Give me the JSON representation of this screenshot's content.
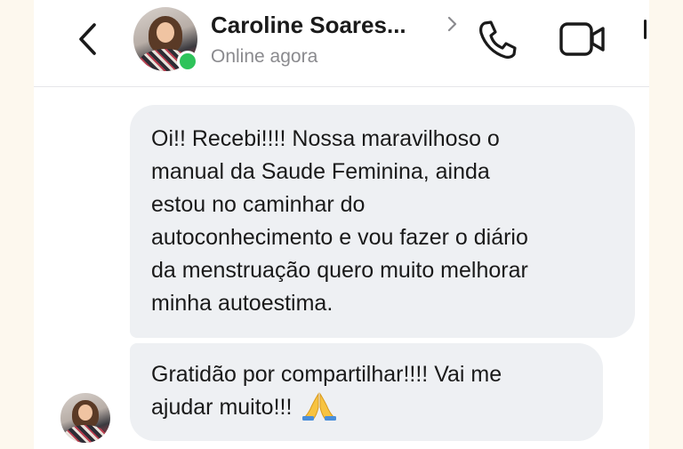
{
  "header": {
    "contact_name": "Caroline Soares...",
    "status": "Online agora",
    "icons": {
      "back": "back-chevron-icon",
      "name_chevron": "chevron-right-icon",
      "call": "phone-icon",
      "video": "video-camera-icon",
      "more": "more-icon"
    },
    "online_color": "#2ec35a"
  },
  "messages": [
    {
      "lines": [
        "Oi!! Recebi!!!! Nossa maravilhoso o",
        "manual da Saude Feminina, ainda",
        "estou no caminhar do",
        "autoconhecimento e vou fazer o diário",
        "da menstruação quero muito melhorar",
        "minha autoestima."
      ]
    },
    {
      "lines": [
        "Gratidão por compartilhar!!!! Vai me",
        "ajudar muito!!!"
      ],
      "emoji": "praying-hands-emoji"
    }
  ],
  "colors": {
    "bubble": "#eef0f3",
    "text": "#1a1a1a",
    "status": "#8a8a8e"
  }
}
